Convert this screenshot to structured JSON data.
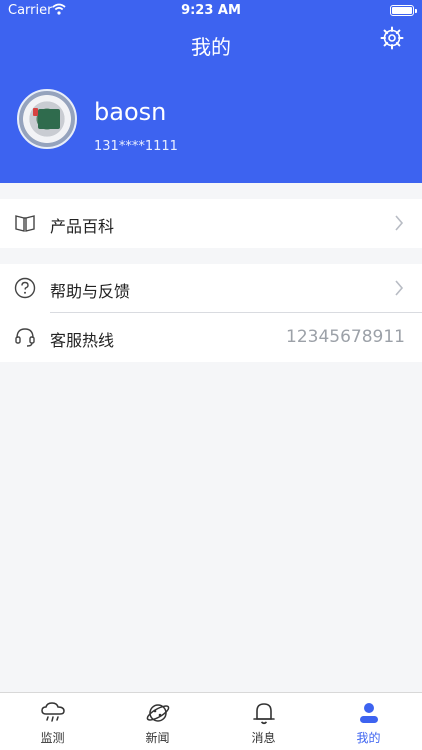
{
  "status_bar": {
    "carrier": "Carrier",
    "time": "9:23 AM"
  },
  "header": {
    "title": "我的"
  },
  "profile": {
    "username": "baosn",
    "phone": "131****1111"
  },
  "menu": {
    "encyclopedia": {
      "label": "产品百科"
    },
    "help": {
      "label": "帮助与反馈"
    },
    "hotline": {
      "label": "客服热线",
      "value": "12345678911"
    }
  },
  "tabs": [
    {
      "label": "监测",
      "icon": "cloud-icon"
    },
    {
      "label": "新闻",
      "icon": "planet-icon"
    },
    {
      "label": "消息",
      "icon": "bell-icon"
    },
    {
      "label": "我的",
      "icon": "person-icon"
    }
  ],
  "colors": {
    "primary": "#3d63f0",
    "background": "#f5f6f8"
  }
}
